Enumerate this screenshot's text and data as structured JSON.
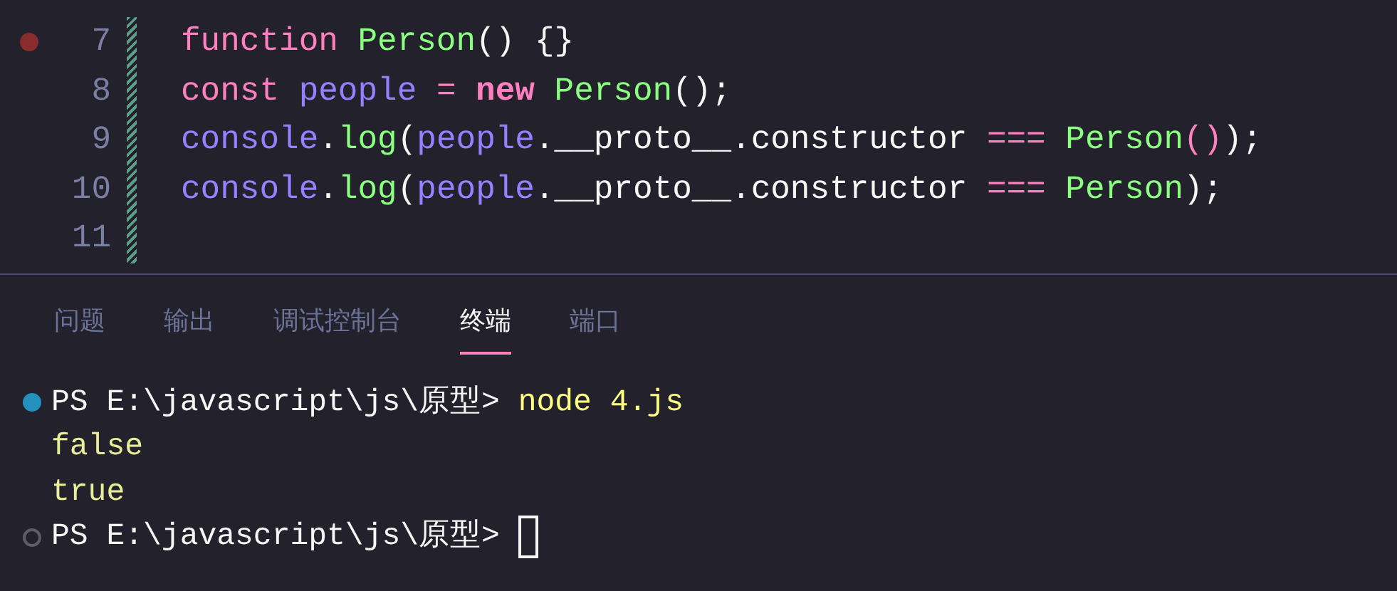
{
  "editor": {
    "lines": [
      {
        "number": "7",
        "breakpoint": true,
        "tokens": [
          {
            "text": "function",
            "kind": "keyword"
          },
          {
            "text": " Person",
            "kind": "function"
          },
          {
            "text": "() {}",
            "kind": "plain"
          }
        ]
      },
      {
        "number": "8",
        "breakpoint": false,
        "tokens": [
          {
            "text": "const",
            "kind": "keyword"
          },
          {
            "text": " people",
            "kind": "variable"
          },
          {
            "text": " =",
            "kind": "operator"
          },
          {
            "text": " new",
            "kind": "new"
          },
          {
            "text": " Person",
            "kind": "function"
          },
          {
            "text": "();",
            "kind": "plain"
          }
        ]
      },
      {
        "number": "9",
        "breakpoint": false,
        "tokens": [
          {
            "text": "console",
            "kind": "variable"
          },
          {
            "text": ".",
            "kind": "plain"
          },
          {
            "text": "log",
            "kind": "function"
          },
          {
            "text": "(",
            "kind": "plain"
          },
          {
            "text": "people",
            "kind": "variable"
          },
          {
            "text": ".__proto__.constructor ",
            "kind": "plain"
          },
          {
            "text": "===",
            "kind": "operator"
          },
          {
            "text": " Person",
            "kind": "function"
          },
          {
            "text": "()",
            "kind": "bracket"
          },
          {
            "text": ");",
            "kind": "plain"
          }
        ]
      },
      {
        "number": "10",
        "breakpoint": false,
        "tokens": [
          {
            "text": "console",
            "kind": "variable"
          },
          {
            "text": ".",
            "kind": "plain"
          },
          {
            "text": "log",
            "kind": "function"
          },
          {
            "text": "(",
            "kind": "plain"
          },
          {
            "text": "people",
            "kind": "variable"
          },
          {
            "text": ".__proto__.constructor ",
            "kind": "plain"
          },
          {
            "text": "===",
            "kind": "operator"
          },
          {
            "text": " Person",
            "kind": "function"
          },
          {
            "text": ");",
            "kind": "plain"
          }
        ]
      },
      {
        "number": "11",
        "breakpoint": false
      }
    ]
  },
  "panel": {
    "tabs": [
      {
        "label": "问题",
        "selected": false
      },
      {
        "label": "输出",
        "selected": false
      },
      {
        "label": "调试控制台",
        "selected": false
      },
      {
        "label": "终端",
        "selected": true
      },
      {
        "label": "端口",
        "selected": false
      }
    ]
  },
  "terminal": {
    "lines": [
      {
        "kind": "prompt",
        "succeeded": true,
        "prompt": "PS E:\\javascript\\js\\原型>",
        "command": "node 4.js",
        "cursor": false
      },
      {
        "kind": "output",
        "text": "false"
      },
      {
        "kind": "output",
        "text": "true"
      },
      {
        "kind": "prompt",
        "succeeded": false,
        "prompt": "PS E:\\javascript\\js\\原型>",
        "cursor": true
      }
    ]
  }
}
